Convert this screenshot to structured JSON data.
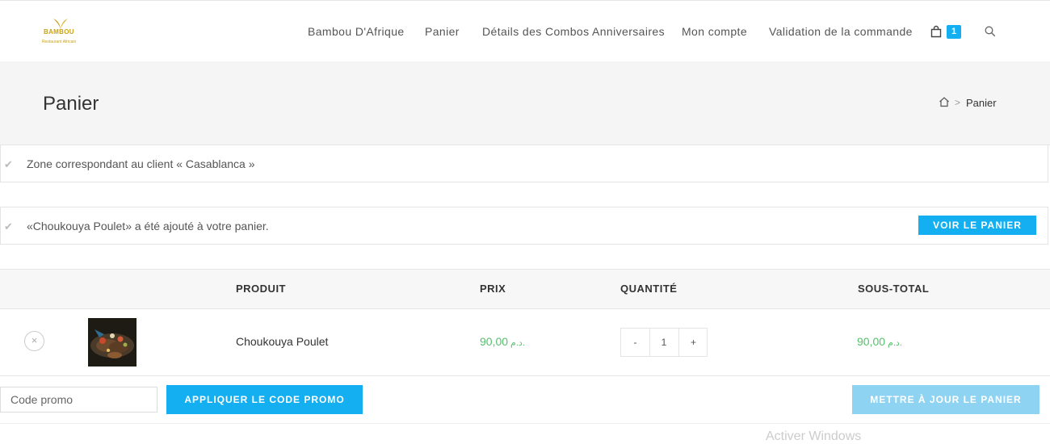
{
  "header": {
    "logo_text": "BAMBOU",
    "logo_subtext": "Restaurant Africain",
    "nav": [
      "Bambou D'Afrique",
      "Panier",
      "Détails des Combos Anniversaires",
      "Mon compte",
      "Validation de la commande"
    ],
    "cart_count": "1",
    "icons": [
      "cart-icon",
      "search-icon"
    ]
  },
  "page": {
    "title": "Panier",
    "breadcrumb_sep": ">",
    "breadcrumb_current": "Panier"
  },
  "notices": {
    "zone": "Zone correspondant au client « Casablanca »",
    "added": "«Choukouya Poulet» a été ajouté à votre panier.",
    "view_cart": "VOIR LE PANIER"
  },
  "table": {
    "headers": [
      "PRODUIT",
      "PRIX",
      "QUANTITÉ",
      "SOUS-TOTAL"
    ],
    "rows": [
      {
        "product": "Choukouya Poulet",
        "price": "90,00",
        "currency": "د.م.",
        "qty_minus": "-",
        "quantity": "1",
        "qty_plus": "+",
        "subtotal": "90,00",
        "subtotal_currency": "د.م.",
        "remove": "×"
      }
    ]
  },
  "actions": {
    "coupon_placeholder": "Code promo",
    "apply_coupon": "APPLIQUER LE CODE PROMO",
    "update_cart": "METTRE À JOUR LE PANIER"
  },
  "watermark": "Activer Windows",
  "colors": {
    "accent": "#13aff0",
    "price": "#57bf6d",
    "logo": "#c9a31c",
    "update_button": "#8fd3f3"
  }
}
